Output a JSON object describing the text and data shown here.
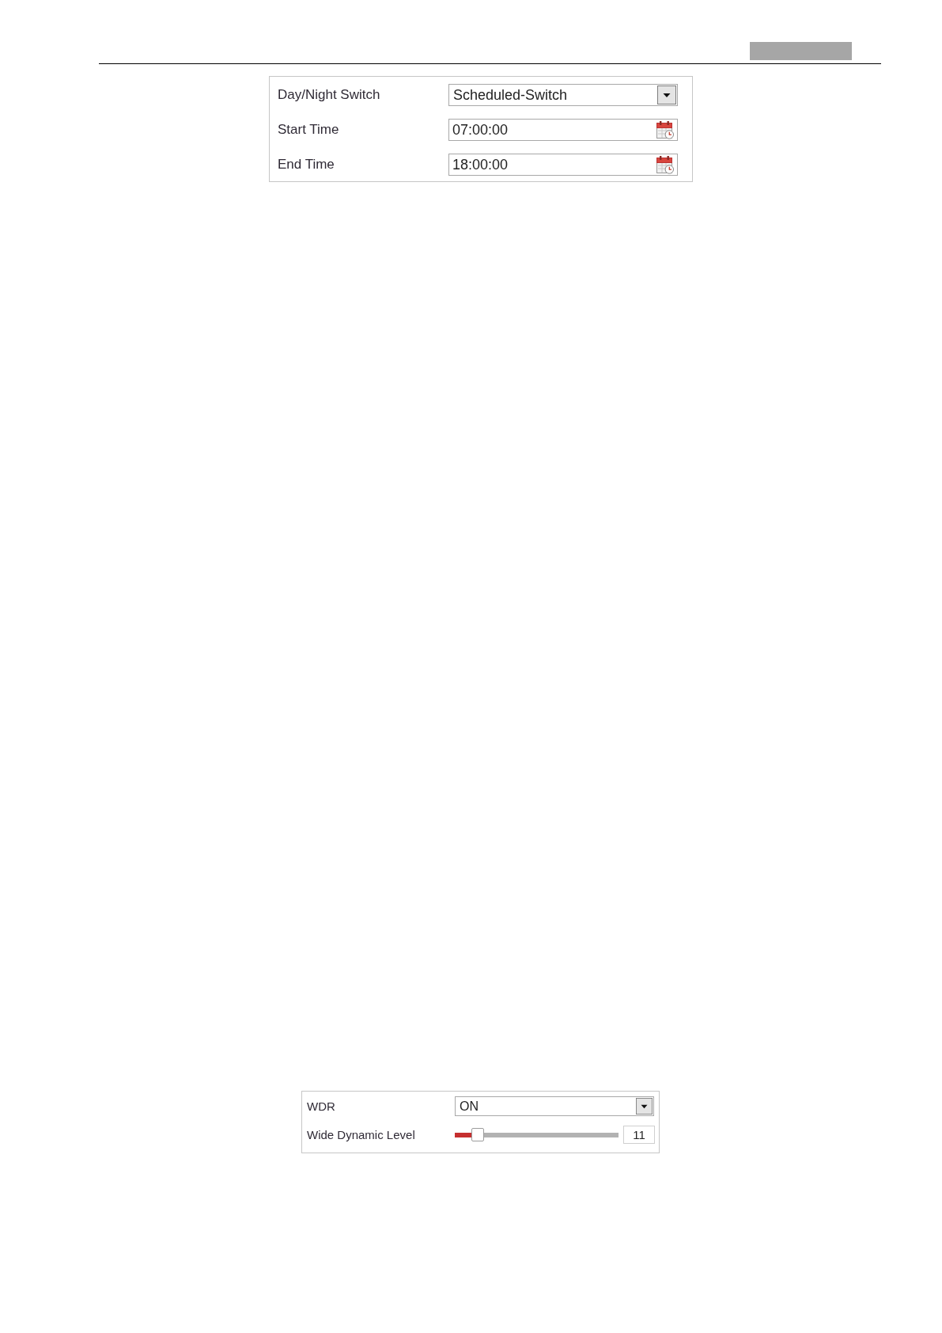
{
  "day_night_panel": {
    "rows": [
      {
        "kind": "select",
        "label": "Day/Night Switch",
        "value": "Scheduled-Switch"
      },
      {
        "kind": "time",
        "label": "Start Time",
        "value": "07:00:00"
      },
      {
        "kind": "time",
        "label": "End Time",
        "value": "18:00:00"
      }
    ]
  },
  "wdr_panel": {
    "rows": [
      {
        "kind": "select",
        "label": "WDR",
        "value": "ON"
      },
      {
        "kind": "slider",
        "label": "Wide Dynamic Level",
        "level": 0.11,
        "value": "11"
      }
    ]
  }
}
